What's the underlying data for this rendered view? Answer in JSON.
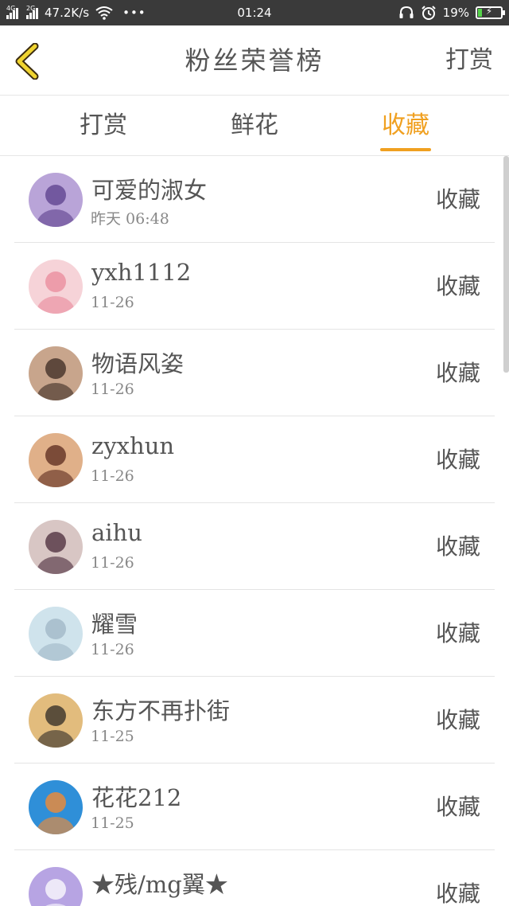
{
  "status_bar": {
    "net1": "4G",
    "net2": "2G",
    "speed": "47.2K/s",
    "more": "•••",
    "time": "01:24",
    "battery_text": "19%",
    "battery_level": 0.19,
    "battery_charging_glyph": "⚡"
  },
  "header": {
    "title": "粉丝荣誉榜",
    "action": "打赏"
  },
  "tabs": [
    {
      "label": "打赏",
      "active": false
    },
    {
      "label": "鲜花",
      "active": false
    },
    {
      "label": "收藏",
      "active": true
    }
  ],
  "rows": [
    {
      "name": "可爱的淑女",
      "date": "昨天 06:48",
      "tag": "收藏",
      "avatar": {
        "bg": "#b9a4d8",
        "fg": "#5b3f8c"
      }
    },
    {
      "name": "yxh1112",
      "date": "11-26",
      "tag": "收藏",
      "avatar": {
        "bg": "#f6d3d8",
        "fg": "#e9899b"
      }
    },
    {
      "name": "物语风姿",
      "date": "11-26",
      "tag": "收藏",
      "avatar": {
        "bg": "#c8a58c",
        "fg": "#3b2a22"
      }
    },
    {
      "name": "zyxhun",
      "date": "11-26",
      "tag": "收藏",
      "avatar": {
        "bg": "#e0b089",
        "fg": "#5a2a1d"
      }
    },
    {
      "name": "aihu",
      "date": "11-26",
      "tag": "收藏",
      "avatar": {
        "bg": "#d8c6c4",
        "fg": "#4a2a3a"
      }
    },
    {
      "name": "耀雪",
      "date": "11-26",
      "tag": "收藏",
      "avatar": {
        "bg": "#cfe3ec",
        "fg": "#9fb6c6"
      }
    },
    {
      "name": "东方不再扑街",
      "date": "11-25",
      "tag": "收藏",
      "avatar": {
        "bg": "#e2bc7d",
        "fg": "#2e2a26"
      }
    },
    {
      "name": "花花212",
      "date": "11-25",
      "tag": "收藏",
      "avatar": {
        "bg": "#2f8fd8",
        "fg": "#ff8a2a"
      }
    },
    {
      "name": "★残/mg翼★",
      "date": "",
      "tag": "收藏",
      "avatar": {
        "bg": "#b7a4e3",
        "fg": "#ffffff"
      }
    }
  ]
}
